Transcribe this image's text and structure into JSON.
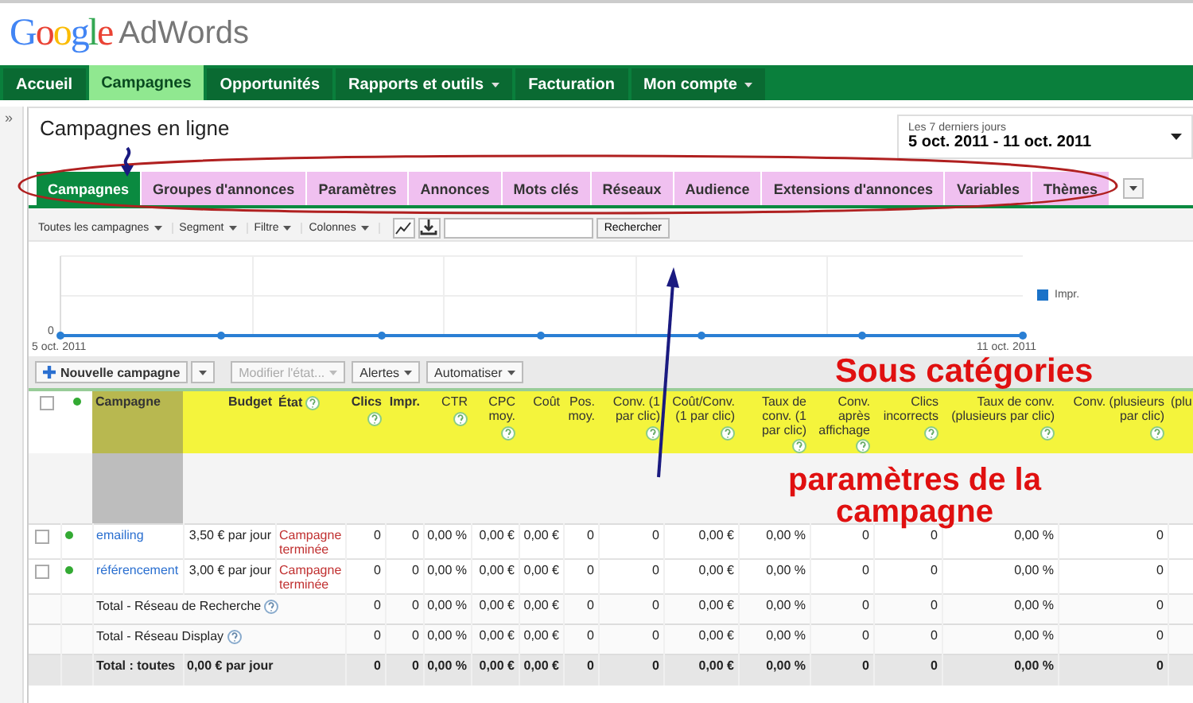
{
  "logo": {
    "brand": "Google",
    "product": "AdWords"
  },
  "nav": [
    {
      "label": "Accueil",
      "selected": false,
      "dropdown": false
    },
    {
      "label": "Campagnes",
      "selected": true,
      "dropdown": false
    },
    {
      "label": "Opportunités",
      "selected": false,
      "dropdown": false
    },
    {
      "label": "Rapports et outils",
      "selected": false,
      "dropdown": true
    },
    {
      "label": "Facturation",
      "selected": false,
      "dropdown": false
    },
    {
      "label": "Mon compte",
      "selected": false,
      "dropdown": true
    }
  ],
  "sidebar_toggle": "»",
  "page_title": "Campagnes en ligne",
  "date_range": {
    "label": "Les 7 derniers jours",
    "value": "5 oct. 2011 - 11 oct. 2011"
  },
  "tabs": [
    {
      "label": "Campagnes",
      "selected": true
    },
    {
      "label": "Groupes d'annonces",
      "selected": false
    },
    {
      "label": "Paramètres",
      "selected": false
    },
    {
      "label": "Annonces",
      "selected": false
    },
    {
      "label": "Mots clés",
      "selected": false
    },
    {
      "label": "Réseaux",
      "selected": false
    },
    {
      "label": "Audience",
      "selected": false
    },
    {
      "label": "Extensions d'annonces",
      "selected": false
    },
    {
      "label": "Variables",
      "selected": false
    },
    {
      "label": "Thèmes",
      "selected": false
    }
  ],
  "toolbar": {
    "menus": [
      "Toutes les campagnes",
      "Segment",
      "Filtre",
      "Colonnes"
    ],
    "search_button": "Rechercher"
  },
  "chart": {
    "y_tick": "0",
    "x_start": "5 oct. 2011",
    "x_end": "11 oct. 2011",
    "legend": "Impr."
  },
  "actions": [
    {
      "label": "Nouvelle campagne",
      "kind": "primary",
      "disabled": false
    },
    {
      "label": "Modifier l'état...",
      "kind": "menu",
      "disabled": true
    },
    {
      "label": "Alertes",
      "kind": "menu",
      "disabled": false
    },
    {
      "label": "Automatiser",
      "kind": "menu",
      "disabled": false
    }
  ],
  "table": {
    "select_all_checked": false,
    "columns": [
      {
        "label": "Campagne",
        "help": false
      },
      {
        "label": "Budget",
        "help": false
      },
      {
        "label": "État",
        "help": true
      },
      {
        "label": "Clics",
        "help": true
      },
      {
        "label": "Impr.",
        "help": false
      },
      {
        "label": "CTR",
        "help": true
      },
      {
        "label": "CPC moy.",
        "help": true
      },
      {
        "label": "Coût",
        "help": false
      },
      {
        "label": "Pos. moy.",
        "help": false
      },
      {
        "label": "Conv. (1 par clic)",
        "help": true
      },
      {
        "label": "Coût/Conv. (1 par clic)",
        "help": true
      },
      {
        "label": "Taux de conv. (1 par clic)",
        "help": true
      },
      {
        "label": "Conv. après affichage",
        "help": true
      },
      {
        "label": "Clics incorrects",
        "help": true
      },
      {
        "label": "Taux de conv. (plusieurs par clic)",
        "help": true
      },
      {
        "label": "Conv. (plusieurs par clic)",
        "help": true
      },
      {
        "label": "(plu",
        "help": false
      }
    ],
    "rows": [
      {
        "kind": "campaign",
        "checked": false,
        "color": "#33aa33",
        "name": "emailing",
        "budget": "3,50 € par jour",
        "status": "Campagne terminée",
        "values": [
          "0",
          "0",
          "0,00 %",
          "0,00 €",
          "0,00 €",
          "0",
          "0",
          "0,00 €",
          "0,00 %",
          "0",
          "0",
          "0,00 %",
          "0"
        ]
      },
      {
        "kind": "campaign",
        "checked": false,
        "color": "#33aa33",
        "name": "référencement",
        "budget": "3,00 € par jour",
        "status": "Campagne terminée",
        "values": [
          "0",
          "0",
          "0,00 %",
          "0,00 €",
          "0,00 €",
          "0",
          "0",
          "0,00 €",
          "0,00 %",
          "0",
          "0",
          "0,00 %",
          "0"
        ]
      },
      {
        "kind": "network_total",
        "name": "Total - Réseau de Recherche",
        "values": [
          "0",
          "0",
          "0,00 %",
          "0,00 €",
          "0,00 €",
          "0",
          "0",
          "0,00 €",
          "0,00 %",
          "0",
          "0",
          "0,00 %",
          "0"
        ]
      },
      {
        "kind": "network_total",
        "name": "Total - Réseau Display",
        "values": [
          "0",
          "0",
          "0,00 %",
          "0,00 €",
          "0,00 €",
          "0",
          "0",
          "0,00 €",
          "0,00 %",
          "0",
          "0",
          "0,00 %",
          "0"
        ]
      },
      {
        "kind": "grand_total",
        "name": "Total : toutes",
        "budget": "0,00 € par jour",
        "values": [
          "0",
          "0",
          "0,00 %",
          "0,00 €",
          "0,00 €",
          "0",
          "0",
          "0,00 €",
          "0,00 %",
          "0",
          "0",
          "0,00 %",
          "0"
        ]
      }
    ]
  },
  "annotations": [
    {
      "text": "Sous catégories"
    },
    {
      "text": "paramètres de la campagne"
    }
  ]
}
